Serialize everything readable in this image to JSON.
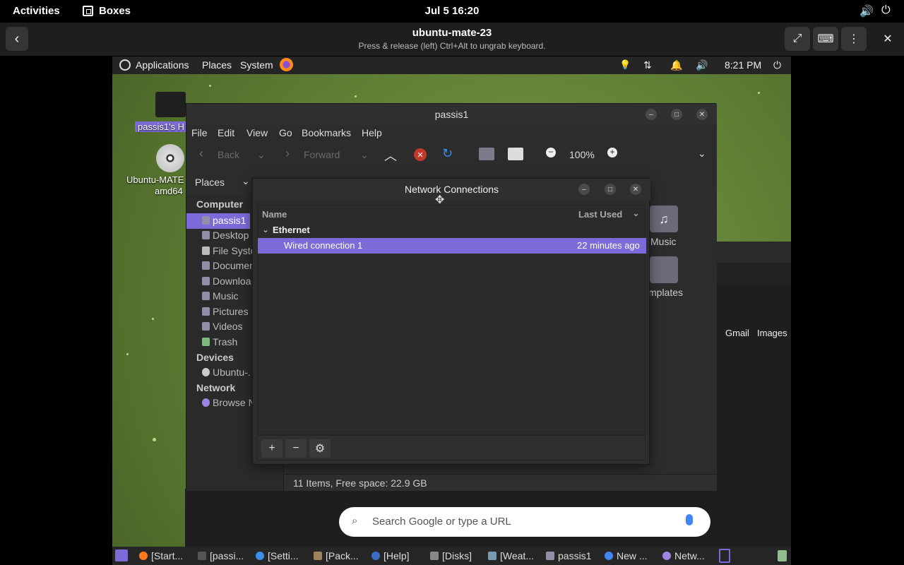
{
  "gnome": {
    "activities": "Activities",
    "app_menu": "Boxes",
    "clock": "Jul 5  16:20"
  },
  "boxes": {
    "title": "ubuntu-mate-23",
    "subtitle": "Press & release (left) Ctrl+Alt to ungrab keyboard."
  },
  "mate_panel": {
    "menus": [
      "Applications",
      "Places",
      "System"
    ],
    "time": "8:21 PM"
  },
  "desktop": {
    "icons": [
      {
        "label": "passis1's H"
      },
      {
        "label": "Ubuntu-MATE",
        "label2": "amd64"
      }
    ]
  },
  "caja": {
    "title": "passis1",
    "menubar": [
      "File",
      "Edit",
      "View",
      "Go",
      "Bookmarks",
      "Help"
    ],
    "toolbar": {
      "back": "Back",
      "forward": "Forward",
      "zoom": "100%"
    },
    "places_label": "Places",
    "sidebar": {
      "computer_header": "Computer",
      "computer": [
        "passis1",
        "Desktop",
        "File Syste",
        "Documer",
        "Downloa",
        "Music",
        "Pictures",
        "Videos",
        "Trash"
      ],
      "devices_header": "Devices",
      "devices": [
        "Ubuntu-."
      ],
      "network_header": "Network",
      "network": [
        "Browse N"
      ]
    },
    "folders_right": [
      {
        "label": "Music"
      },
      {
        "label": "mplates"
      }
    ],
    "status": "11 Items, Free space: 22.9 GB"
  },
  "netconn": {
    "title": "Network Connections",
    "col_name": "Name",
    "col_last_used": "Last Used",
    "group": "Ethernet",
    "connections": [
      {
        "name": "Wired connection 1",
        "last_used": "22 minutes ago"
      }
    ]
  },
  "chrome": {
    "search_placeholder": "Search Google or type a URL",
    "links": [
      "Gmail",
      "Images"
    ]
  },
  "taskbar": {
    "items": [
      "[Start...",
      "[passi...",
      "[Setti...",
      "[Pack...",
      "[Help]",
      "[Disks]",
      "[Weat...",
      "passis1",
      "New ...",
      "Netw..."
    ]
  },
  "colors": {
    "selection": "#7b6ad8",
    "desktop_green": "#66883b"
  }
}
